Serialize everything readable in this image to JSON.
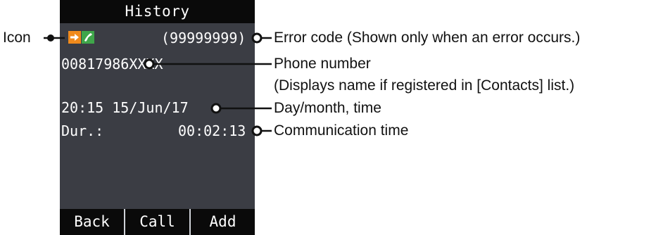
{
  "screen": {
    "title": "History",
    "error_code": "(99999999)",
    "phone_number": "00817986XXXX",
    "datetime": "20:15 15/Jun/17",
    "duration_label": "Dur.:",
    "duration_value": "00:02:13",
    "softkeys": [
      "Back",
      "Call",
      "Add"
    ],
    "colors": {
      "screen_bg": "#3b3d44",
      "bar_bg": "#0a0a0a",
      "forward_icon": "#f08a1c",
      "phone_icon": "#3fa64a"
    },
    "icons": [
      "forward-arrow-icon",
      "phone-handset-icon"
    ]
  },
  "callouts": {
    "icon": "Icon",
    "error_code": "Error code (Shown only when an error occurs.)",
    "phone_number": "Phone number",
    "phone_number_note": "(Displays name if registered in [Contacts] list.)",
    "datetime": "Day/month, time",
    "comm_time": "Communication time"
  }
}
